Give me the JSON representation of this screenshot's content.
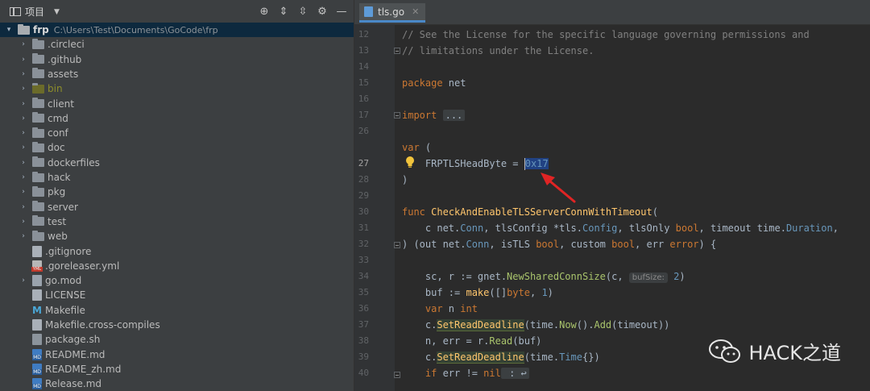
{
  "project_panel": {
    "title": "项目",
    "root": {
      "name": "frp",
      "path": "C:\\Users\\Test\\Documents\\GoCode\\frp"
    },
    "folders": [
      ".circleci",
      ".github",
      "assets",
      "bin",
      "client",
      "cmd",
      "conf",
      "doc",
      "dockerfiles",
      "hack",
      "pkg",
      "server",
      "test",
      "web"
    ],
    "files": [
      {
        "name": ".gitignore",
        "icon": "text-file-icon"
      },
      {
        "name": ".goreleaser.yml",
        "icon": "yml-file-icon"
      },
      {
        "name": "go.mod",
        "icon": "go-mod-file-icon"
      },
      {
        "name": "LICENSE",
        "icon": "text-file-icon"
      },
      {
        "name": "Makefile",
        "icon": "makefile-icon"
      },
      {
        "name": "Makefile.cross-compiles",
        "icon": "text-file-icon"
      },
      {
        "name": "package.sh",
        "icon": "shell-file-icon"
      },
      {
        "name": "README.md",
        "icon": "markdown-file-icon"
      },
      {
        "name": "README_zh.md",
        "icon": "markdown-file-icon"
      },
      {
        "name": "Release.md",
        "icon": "markdown-file-icon"
      }
    ]
  },
  "editor": {
    "tab": "tls.go",
    "line_numbers": [
      "12",
      "13",
      "14",
      "15",
      "16",
      "17",
      "26",
      "27",
      "28",
      "29",
      "30",
      "31",
      "32",
      "33",
      "34",
      "35",
      "36",
      "37",
      "38",
      "39",
      "40"
    ],
    "current_line": "27",
    "lines": {
      "l12": "// See the License for the specific language governing permissions and",
      "l13": "// limitations under the License.",
      "l15_kw": "package",
      "l15_id": " net",
      "l17_kw": "import",
      "l17_fold": "...",
      "l26_kw": "var",
      "l26_rest": " (",
      "l27_name": "    FRPTLSHeadByte = ",
      "l27_val": "0x17",
      "l28": ")",
      "l30_kw": "func",
      "l30_fn": "CheckAndEnableTLSServerConnWithTimeout",
      "l30_rest": "(",
      "l31_a": "    c ",
      "l31_b": "net",
      "l31_c": ".",
      "l31_d": "Conn",
      "l31_e": ", tlsConfig *",
      "l31_f": "tls",
      "l31_g": ".",
      "l31_h": "Config",
      "l31_i": ", tlsOnly ",
      "l31_j": "bool",
      "l31_k": ", timeout ",
      "l31_l": "time",
      "l31_m": ".",
      "l31_n": "Duration",
      "l31_o": ",",
      "l32_a": ") (out ",
      "l32_b": "net",
      "l32_c": ".",
      "l32_d": "Conn",
      "l32_e": ", isTLS ",
      "l32_f": "bool",
      "l32_g": ", custom ",
      "l32_h": "bool",
      "l32_i": ", err ",
      "l32_j": "error",
      "l32_k": ") {",
      "l34_a": "    sc, r := gnet.",
      "l34_fn": "NewSharedConnSize",
      "l34_b": "(c, ",
      "l34_hint": "bufSize:",
      "l34_num": "2",
      "l34_c": ")",
      "l35_a": "    buf := ",
      "l35_fn": "make",
      "l35_b": "([]",
      "l35_kw": "byte",
      "l35_c": ", ",
      "l35_num": "1",
      "l35_d": ")",
      "l36_kw": "    var",
      "l36_a": " n ",
      "l36_ty": "int",
      "l37_a": "    c.",
      "l37_fn": "SetReadDeadline",
      "l37_b": "(time.",
      "l37_fn2": "Now",
      "l37_c": "().",
      "l37_fn3": "Add",
      "l37_d": "(timeout))",
      "l38_a": "    n, err = r.",
      "l38_fn": "Read",
      "l38_b": "(buf)",
      "l39_a": "    c.",
      "l39_fn": "SetReadDeadline",
      "l39_b": "(time.",
      "l39_ty": "Time",
      "l39_c": "{})",
      "l40_kw": "    if",
      "l40_a": " err != ",
      "l40_kw2": "nil",
      "l40_fold": " : ↩"
    }
  },
  "watermark": "HACK之道"
}
